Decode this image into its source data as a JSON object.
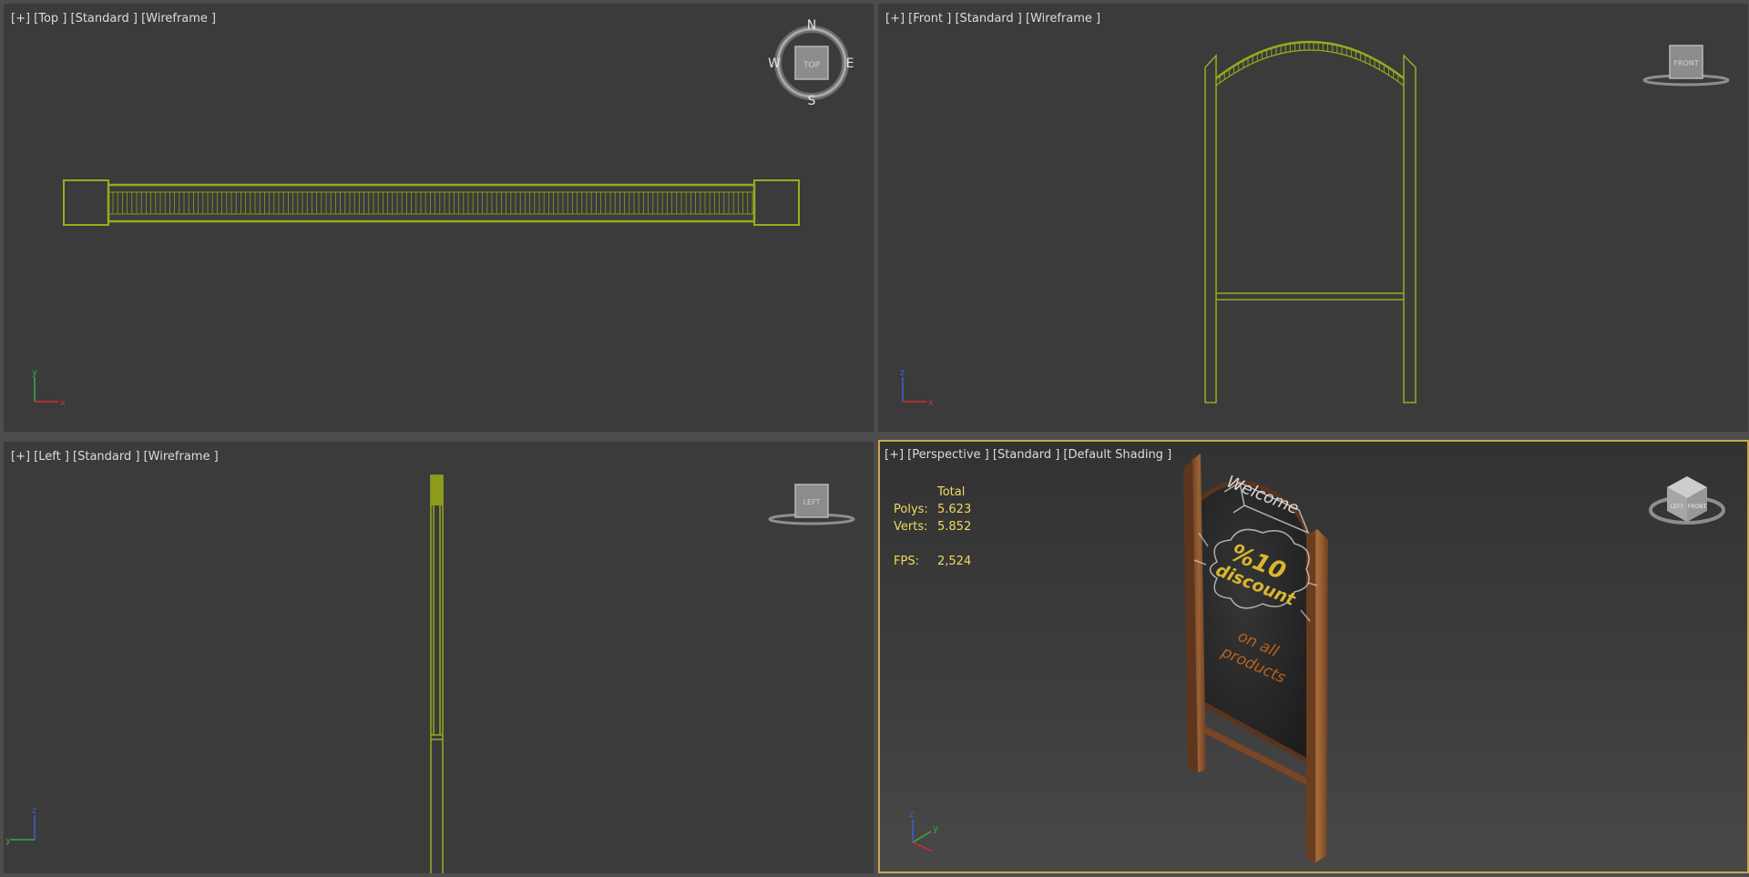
{
  "viewports": {
    "top": {
      "label": "[+] [Top ] [Standard ] [Wireframe ]",
      "gizmo": "TOP",
      "compass": {
        "n": "N",
        "s": "S",
        "e": "E",
        "w": "W"
      },
      "axis": {
        "up": "y",
        "right": "x"
      }
    },
    "front": {
      "label": "[+] [Front ] [Standard ] [Wireframe ]",
      "gizmo": "FRONT",
      "axis": {
        "up": "z",
        "right": "x"
      }
    },
    "left": {
      "label": "[+] [Left ] [Standard ] [Wireframe ]",
      "gizmo": "LEFT",
      "axis": {
        "up": "z",
        "right": "y"
      }
    },
    "perspective": {
      "label": "[+] [Perspective ] [Standard ] [Default Shading ]",
      "gizmo_left": "LEFT",
      "gizmo_front": "FRONT",
      "gizmo_top": "TOP",
      "axis": {
        "up": "z",
        "right": "y"
      }
    }
  },
  "stats": {
    "header": "Total",
    "polys_label": "Polys:",
    "polys_value": "5.623",
    "verts_label": "Verts:",
    "verts_value": "5.852",
    "fps_label": "FPS:",
    "fps_value": "2,524"
  },
  "sign": {
    "welcome": "Welcome",
    "discount_line1": "%10",
    "discount_line2": "discount",
    "products_line1": "on all",
    "products_line2": "products"
  },
  "colors": {
    "wireframe": "#9aab1c",
    "active_border": "#c8a84e",
    "stats_text": "#f2d860",
    "wood": "#8b5430",
    "board": "#262626",
    "chalk_yellow": "#d8b62f",
    "chalk_orange": "#b8621f"
  }
}
